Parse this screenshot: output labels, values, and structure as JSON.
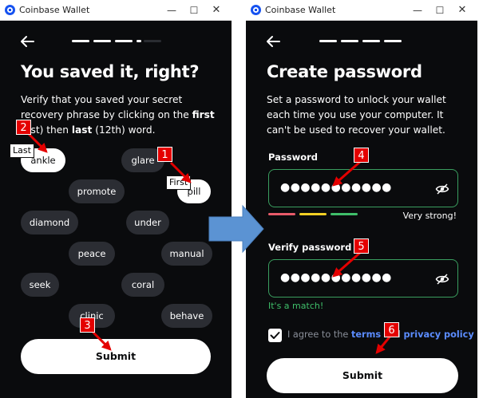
{
  "left_window": {
    "titlebar": {
      "app_title": "Coinbase Wallet"
    },
    "heading": "You saved it, right?",
    "paragraph": {
      "text_start": "Verify that you saved your secret recovery phrase by clicking on the ",
      "first_word": "first",
      "first_note": " (1st) then ",
      "last_word": "last",
      "last_note": " (12th) word."
    },
    "progress_colors": [
      "#ffffff",
      "#ffffff",
      "#ffffff",
      "#ffffff",
      "#2a2c31"
    ],
    "words": [
      {
        "label": "ankle",
        "selected": true
      },
      {
        "label": "glare",
        "selected": false
      },
      {
        "label": "promote",
        "selected": false
      },
      {
        "label": "pill",
        "selected": true
      },
      {
        "label": "diamond",
        "selected": false
      },
      {
        "label": "under",
        "selected": false
      },
      {
        "label": "peace",
        "selected": false
      },
      {
        "label": "manual",
        "selected": false
      },
      {
        "label": "seek",
        "selected": false
      },
      {
        "label": "coral",
        "selected": false
      },
      {
        "label": "clinic",
        "selected": false
      },
      {
        "label": "behave",
        "selected": false
      }
    ],
    "tags": {
      "last": "Last",
      "first": "First"
    },
    "submit_label": "Submit"
  },
  "right_window": {
    "titlebar": {
      "app_title": "Coinbase Wallet"
    },
    "heading": "Create password",
    "paragraph": "Set a password to unlock your wallet each time you use your computer. It can't be used to recover your wallet.",
    "progress_colors": [
      "#ffffff",
      "#ffffff",
      "#ffffff",
      "#ffffff"
    ],
    "password_label": "Password",
    "password_value": "●●●●●●●●●●●",
    "strength_colors": [
      "#e85b6a",
      "#f2d024",
      "#3fbf6a"
    ],
    "strength_text": "Very strong!",
    "verify_label": "Verify password",
    "verify_value": "●●●●●●●●●●●",
    "match_text": "It's a match!",
    "agree": {
      "prefix": "I agree to the ",
      "terms": "terms",
      "and": " and ",
      "privacy": "privacy policy",
      "checked": true
    },
    "submit_label": "Submit"
  },
  "annotations": {
    "step_numbers": [
      "1",
      "2",
      "3",
      "4",
      "5",
      "6"
    ],
    "marker_color": "#e40000",
    "flow_arrow_color": "#5b93d3"
  }
}
